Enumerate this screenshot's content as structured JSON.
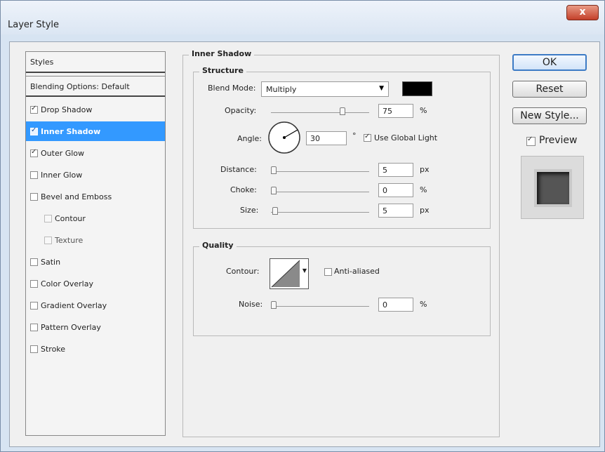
{
  "window": {
    "title": "Layer Style",
    "close_glyph": "x"
  },
  "styles_panel": {
    "header": "Styles",
    "blending_options": "Blending Options: Default",
    "items": [
      {
        "label": "Drop Shadow",
        "checked": true
      },
      {
        "label": "Inner Shadow",
        "checked": true,
        "selected": true
      },
      {
        "label": "Outer Glow",
        "checked": true
      },
      {
        "label": "Inner Glow",
        "checked": false
      },
      {
        "label": "Bevel and Emboss",
        "checked": false
      },
      {
        "label": "Contour",
        "checked": false,
        "sub": true
      },
      {
        "label": "Texture",
        "checked": false,
        "sub": true
      },
      {
        "label": "Satin",
        "checked": false
      },
      {
        "label": "Color Overlay",
        "checked": false
      },
      {
        "label": "Gradient Overlay",
        "checked": false
      },
      {
        "label": "Pattern Overlay",
        "checked": false
      },
      {
        "label": "Stroke",
        "checked": false
      }
    ]
  },
  "inner_shadow": {
    "section_title": "Inner Shadow",
    "structure": {
      "title": "Structure",
      "blend_mode_label": "Blend Mode:",
      "blend_mode_value": "Multiply",
      "blend_color": "#000000",
      "opacity_label": "Opacity:",
      "opacity_value": "75",
      "opacity_unit": "%",
      "angle_label": "Angle:",
      "angle_value": "30",
      "angle_unit": "°",
      "use_global_light_label": "Use Global Light",
      "use_global_light": true,
      "distance_label": "Distance:",
      "distance_value": "5",
      "distance_unit": "px",
      "choke_label": "Choke:",
      "choke_value": "0",
      "choke_unit": "%",
      "size_label": "Size:",
      "size_value": "5",
      "size_unit": "px"
    },
    "quality": {
      "title": "Quality",
      "contour_label": "Contour:",
      "anti_aliased_label": "Anti-aliased",
      "anti_aliased": false,
      "noise_label": "Noise:",
      "noise_value": "0",
      "noise_unit": "%"
    }
  },
  "buttons": {
    "ok": "OK",
    "reset": "Reset",
    "new_style": "New Style...",
    "preview_label": "Preview",
    "preview_checked": true
  }
}
